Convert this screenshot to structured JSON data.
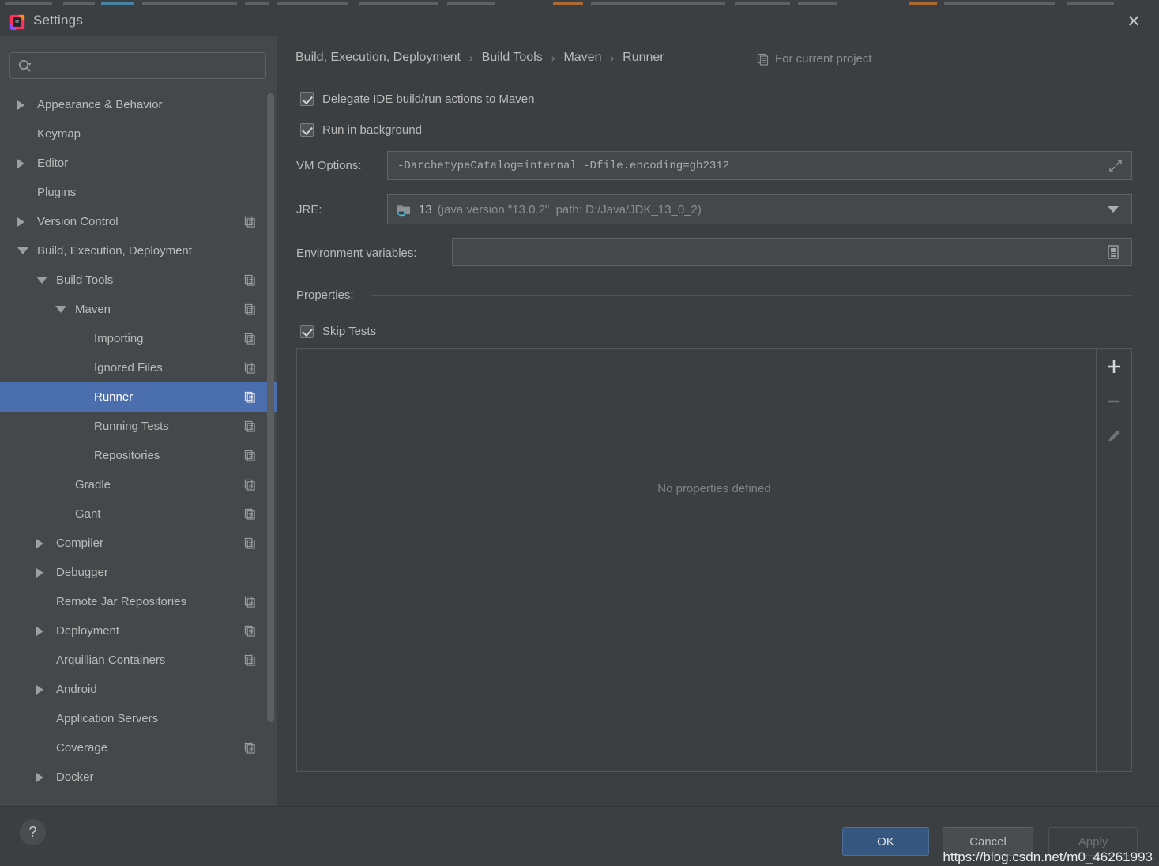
{
  "window": {
    "title": "Settings",
    "logo_icon": "intellij-idea-logo",
    "close_icon": "close-icon"
  },
  "sidebar": {
    "search": {
      "placeholder": "",
      "value": "",
      "icon": "search-icon"
    },
    "items": [
      {
        "label": "Appearance & Behavior",
        "indent": 0,
        "arrow": "collapsed",
        "copy": false,
        "selected": false
      },
      {
        "label": "Keymap",
        "indent": 0,
        "arrow": "none",
        "copy": false,
        "selected": false
      },
      {
        "label": "Editor",
        "indent": 0,
        "arrow": "collapsed",
        "copy": false,
        "selected": false
      },
      {
        "label": "Plugins",
        "indent": 0,
        "arrow": "none",
        "copy": false,
        "selected": false
      },
      {
        "label": "Version Control",
        "indent": 0,
        "arrow": "collapsed",
        "copy": true,
        "selected": false
      },
      {
        "label": "Build, Execution, Deployment",
        "indent": 0,
        "arrow": "expanded",
        "copy": false,
        "selected": false
      },
      {
        "label": "Build Tools",
        "indent": 1,
        "arrow": "expanded",
        "copy": true,
        "selected": false
      },
      {
        "label": "Maven",
        "indent": 2,
        "arrow": "expanded",
        "copy": true,
        "selected": false
      },
      {
        "label": "Importing",
        "indent": 3,
        "arrow": "none",
        "copy": true,
        "selected": false
      },
      {
        "label": "Ignored Files",
        "indent": 3,
        "arrow": "none",
        "copy": true,
        "selected": false
      },
      {
        "label": "Runner",
        "indent": 3,
        "arrow": "none",
        "copy": true,
        "selected": true
      },
      {
        "label": "Running Tests",
        "indent": 3,
        "arrow": "none",
        "copy": true,
        "selected": false
      },
      {
        "label": "Repositories",
        "indent": 3,
        "arrow": "none",
        "copy": true,
        "selected": false
      },
      {
        "label": "Gradle",
        "indent": 2,
        "arrow": "none",
        "copy": true,
        "selected": false
      },
      {
        "label": "Gant",
        "indent": 2,
        "arrow": "none",
        "copy": true,
        "selected": false
      },
      {
        "label": "Compiler",
        "indent": 1,
        "arrow": "collapsed",
        "copy": true,
        "selected": false
      },
      {
        "label": "Debugger",
        "indent": 1,
        "arrow": "collapsed",
        "copy": false,
        "selected": false
      },
      {
        "label": "Remote Jar Repositories",
        "indent": 1,
        "arrow": "none",
        "copy": true,
        "selected": false
      },
      {
        "label": "Deployment",
        "indent": 1,
        "arrow": "collapsed",
        "copy": true,
        "selected": false
      },
      {
        "label": "Arquillian Containers",
        "indent": 1,
        "arrow": "none",
        "copy": true,
        "selected": false
      },
      {
        "label": "Android",
        "indent": 1,
        "arrow": "collapsed",
        "copy": false,
        "selected": false
      },
      {
        "label": "Application Servers",
        "indent": 1,
        "arrow": "none",
        "copy": false,
        "selected": false
      },
      {
        "label": "Coverage",
        "indent": 1,
        "arrow": "none",
        "copy": true,
        "selected": false
      },
      {
        "label": "Docker",
        "indent": 1,
        "arrow": "collapsed",
        "copy": false,
        "selected": false
      }
    ]
  },
  "main": {
    "breadcrumb": [
      "Build, Execution, Deployment",
      "Build Tools",
      "Maven",
      "Runner"
    ],
    "breadcrumb_separator": "›",
    "for_current_project": {
      "label": "For current project",
      "icon": "copy-icon"
    },
    "delegate_checkbox": {
      "label": "Delegate IDE build/run actions to Maven",
      "checked": true,
      "mnemonic": "D"
    },
    "background_checkbox": {
      "label": "Run in background",
      "checked": true,
      "mnemonic": "b"
    },
    "vm_options": {
      "label": "VM Options:",
      "value": "-DarchetypeCatalog=internal -Dfile.encoding=gb2312",
      "expand_icon": "expand-icon"
    },
    "jre": {
      "label": "JRE:",
      "icon": "jdk-folder-icon",
      "name": "13",
      "description": "(java version \"13.0.2\", path: D:/Java/JDK_13_0_2)",
      "caret_icon": "chevron-down-icon"
    },
    "environment_variables": {
      "label": "Environment variables:",
      "value": "",
      "browse_icon": "list-browse-icon"
    },
    "properties_section_label": "Properties:",
    "skip_tests_checkbox": {
      "label": "Skip Tests",
      "checked": true,
      "mnemonic": "T"
    },
    "properties_panel": {
      "empty_text": "No properties defined",
      "toolbar": [
        {
          "icon": "plus-icon",
          "name": "add-property-button",
          "enabled": true
        },
        {
          "icon": "minus-icon",
          "name": "remove-property-button",
          "enabled": false
        },
        {
          "icon": "pencil-icon",
          "name": "edit-property-button",
          "enabled": false
        }
      ]
    }
  },
  "footer": {
    "help_label": "?",
    "ok_label": "OK",
    "cancel_label": "Cancel",
    "apply_label": "Apply",
    "watermark": "https://blog.csdn.net/m0_46261993"
  },
  "colors": {
    "window_bg": "#3c3f41",
    "sidebar_bg": "#45484a",
    "selection_blue": "#4b6eaf",
    "primary_button": "#365880",
    "text": "#bbbbbb",
    "muted_text": "#8b8f91"
  }
}
